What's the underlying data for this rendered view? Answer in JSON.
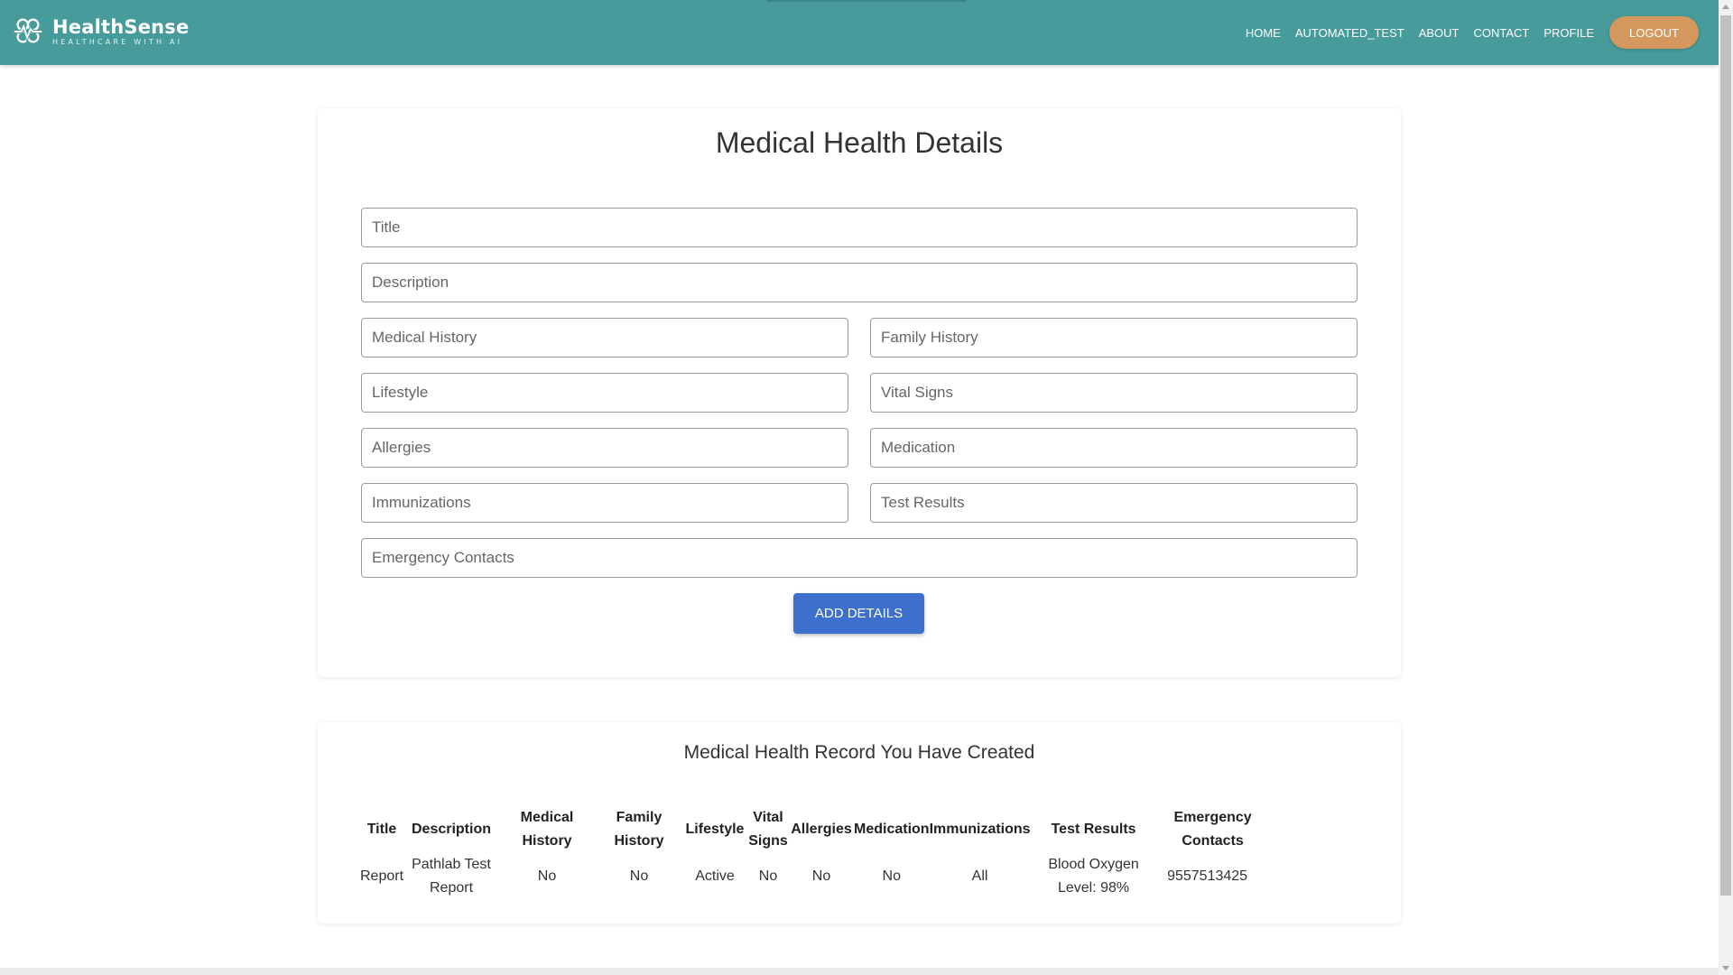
{
  "brand": {
    "name": "HealthSense",
    "tagline": "HEALTHCARE WITH AI"
  },
  "nav": {
    "links": [
      "HOME",
      "AUTOMATED_TEST",
      "ABOUT",
      "CONTACT",
      "PROFILE"
    ],
    "logout_label": "LOGOUT"
  },
  "colors": {
    "navbar": "#479b9b",
    "logout": "#d4985f",
    "primary_button": "#3d6fcd"
  },
  "form": {
    "title": "Medical Health Details",
    "fields": {
      "title": {
        "placeholder": "Title",
        "value": ""
      },
      "description": {
        "placeholder": "Description",
        "value": ""
      },
      "medical_history": {
        "placeholder": "Medical History",
        "value": ""
      },
      "family_history": {
        "placeholder": "Family History",
        "value": ""
      },
      "lifestyle": {
        "placeholder": "Lifestyle",
        "value": ""
      },
      "vital_signs": {
        "placeholder": "Vital Signs",
        "value": ""
      },
      "allergies": {
        "placeholder": "Allergies",
        "value": ""
      },
      "medication": {
        "placeholder": "Medication",
        "value": ""
      },
      "immunizations": {
        "placeholder": "Immunizations",
        "value": ""
      },
      "test_results": {
        "placeholder": "Test Results",
        "value": ""
      },
      "emergency_contacts": {
        "placeholder": "Emergency Contacts",
        "value": ""
      }
    },
    "submit_label": "ADD DETAILS"
  },
  "records": {
    "title": "Medical Health Record You Have Created",
    "columns": [
      "Title",
      "Description",
      "Medical History",
      "Family History",
      "Lifestyle",
      "Vital Signs",
      "Allergies",
      "Medication",
      "Immunizations",
      "Test Results",
      "Emergency Contacts"
    ],
    "rows": [
      [
        "Report",
        "Pathlab Test Report",
        "No",
        "No",
        "Active",
        "No",
        "No",
        "No",
        "All",
        "Blood Oxygen Level: 98%",
        "9557513425"
      ]
    ]
  }
}
